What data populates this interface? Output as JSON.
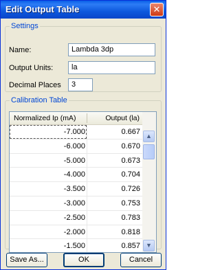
{
  "window": {
    "title": "Edit Output Table",
    "close": "✕"
  },
  "settings": {
    "legend": "Settings",
    "name_label": "Name:",
    "name_value": "Lambda 3dp",
    "units_label": "Output Units:",
    "units_value": "la",
    "decimals_label": "Decimal Places",
    "decimals_value": "3"
  },
  "calibration": {
    "legend": "Calibration Table",
    "columns": [
      "Normalized Ip (mA)",
      "Output (la)"
    ],
    "rows": [
      [
        "-7.000",
        "0.667"
      ],
      [
        "-6.000",
        "0.670"
      ],
      [
        "-5.000",
        "0.673"
      ],
      [
        "-4.000",
        "0.704"
      ],
      [
        "-3.500",
        "0.726"
      ],
      [
        "-3.000",
        "0.753"
      ],
      [
        "-2.500",
        "0.783"
      ],
      [
        "-2.000",
        "0.818"
      ],
      [
        "-1.500",
        "0.857"
      ]
    ]
  },
  "buttons": {
    "save_as": "Save As...",
    "ok": "OK",
    "cancel": "Cancel"
  },
  "icons": {
    "scroll_up": "chevron-up-icon",
    "scroll_down": "chevron-down-icon"
  }
}
